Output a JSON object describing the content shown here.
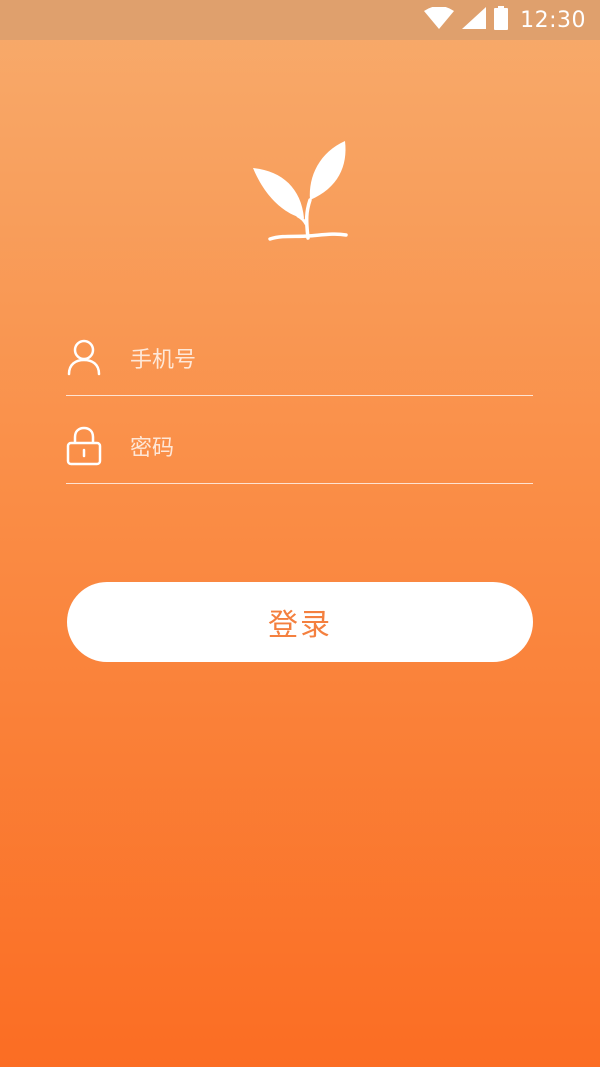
{
  "status_bar": {
    "time": "12:30",
    "icons": [
      "wifi-icon",
      "cell-signal-icon",
      "battery-icon"
    ]
  },
  "logo": {
    "icon": "sprout-icon"
  },
  "form": {
    "phone": {
      "icon": "user-icon",
      "value": "",
      "placeholder": "手机号"
    },
    "password": {
      "icon": "lock-icon",
      "value": "",
      "placeholder": "密码"
    },
    "login_label": "登录"
  },
  "colors": {
    "gradient_top": "#f7ab6c",
    "gradient_bottom": "#fb6d23",
    "status_bar": "#dfa06d",
    "button_text": "#f4803f",
    "button_bg": "#ffffff"
  }
}
